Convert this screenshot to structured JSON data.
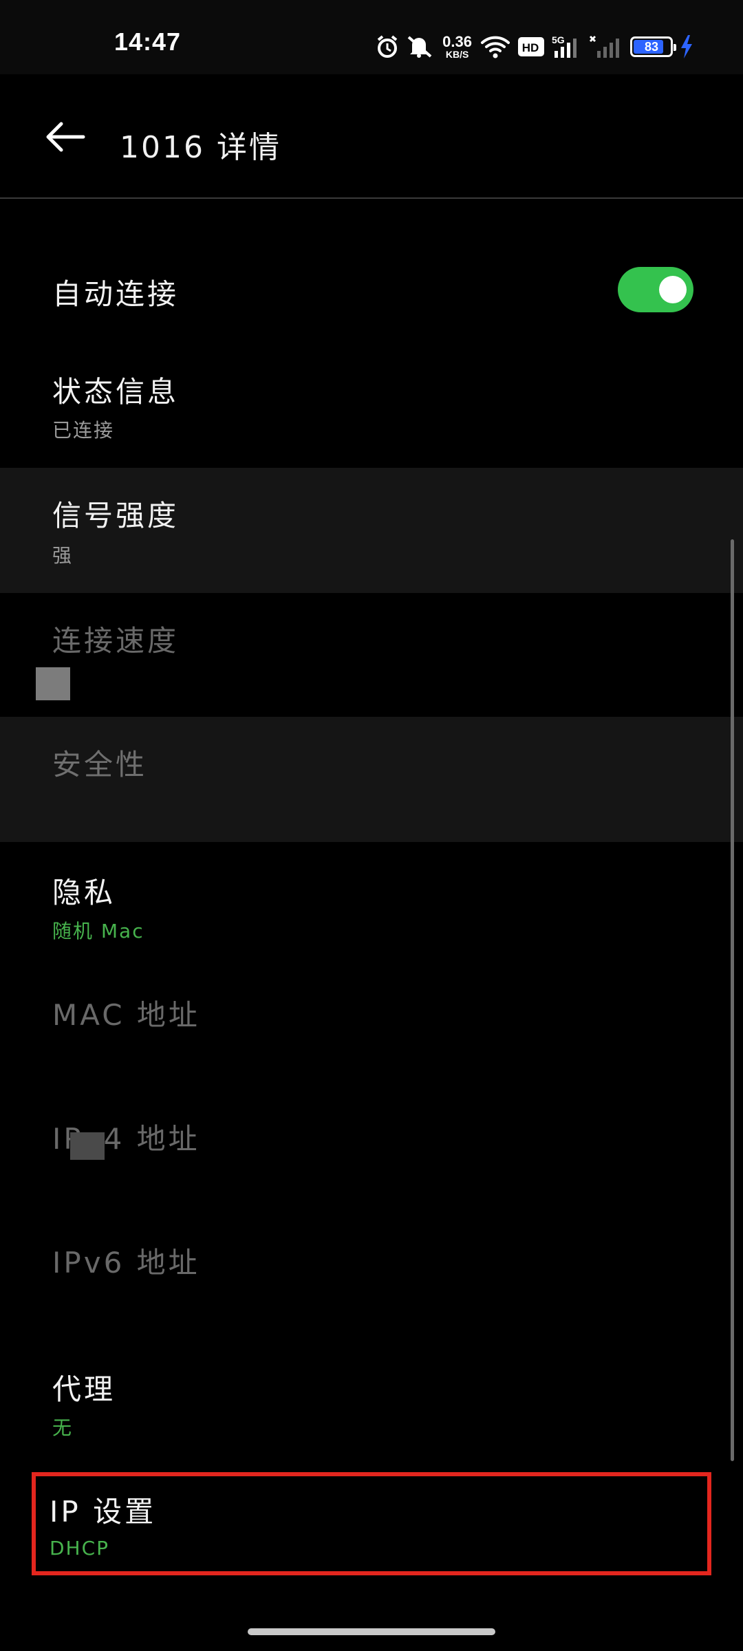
{
  "status_bar": {
    "time": "14:47",
    "net_speed_value": "0.36",
    "net_speed_unit": "KB/S",
    "hd_badge": "HD",
    "network_type": "5G",
    "battery_level": "83",
    "battery_fraction": 0.83,
    "icons": [
      "alarm-icon",
      "mute-icon",
      "wifi-icon",
      "hd-icon",
      "signal-5g-icon",
      "signal-no-service-icon",
      "battery-icon",
      "charging-icon"
    ]
  },
  "header": {
    "back_icon": "arrow-left-icon",
    "title": "1016 详情"
  },
  "rows": {
    "auto_connect": {
      "title": "自动连接",
      "toggle_on": true
    },
    "status": {
      "title": "状态信息",
      "subtitle": "已连接"
    },
    "signal": {
      "title": "信号强度",
      "subtitle": "强"
    },
    "link_speed": {
      "title": "连接速度"
    },
    "security": {
      "title": "安全性"
    },
    "privacy": {
      "title": "隐私",
      "subtitle": "随机 Mac"
    },
    "mac": {
      "title": "MAC 地址"
    },
    "ipv4": {
      "title": "IPv4 地址"
    },
    "ipv6": {
      "title": "IPv6 地址"
    },
    "proxy": {
      "title": "代理",
      "subtitle": "无"
    },
    "ip_settings": {
      "title": "IP 设置",
      "subtitle": "DHCP"
    }
  },
  "colors": {
    "toggle_on": "#34c24e",
    "accent_green": "#47b34d",
    "highlight_red": "#e3261e",
    "battery_fill": "#2d64ff"
  }
}
